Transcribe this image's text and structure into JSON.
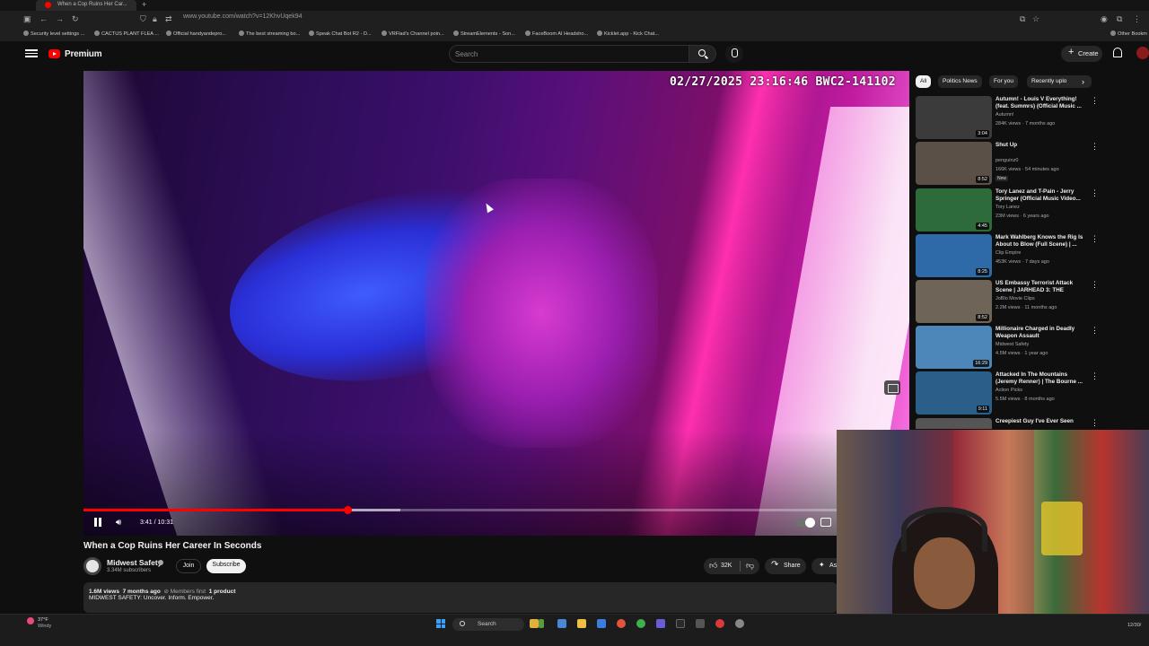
{
  "browser": {
    "tab_title": "When a Cop Ruins Her Car...",
    "url": "www.youtube.com/watch?v=12KhvUqek94",
    "bookmarks": [
      "Security level settings ...",
      "CACTUS PLANT FLEA ...",
      "Official handyandepro...",
      "The best streaming bo...",
      "Speak Chat Bot R2 - D...",
      "VRFlad's Channel poin...",
      "StreamElements - Son...",
      "FaceBoom AI Headsho...",
      "Kicklet.app - Kick Chat..."
    ],
    "other_bookmarks": "Other Bookm"
  },
  "header": {
    "logo_text": "Premium",
    "search_placeholder": "Search",
    "create_label": "Create"
  },
  "player": {
    "overlay_timestamp": "02/27/2025 23:16:46 BWC2-141102",
    "current_time": "3:41",
    "duration": "10:31",
    "time_display": "3:41 / 10:31",
    "progress_fraction": 0.35,
    "buffered_fraction": 0.42,
    "state": "playing"
  },
  "video": {
    "title": "When a Cop Ruins Her Career In Seconds",
    "channel": "Midwest Safety",
    "subscribers": "3.34M subscribers",
    "join_label": "Join",
    "subscribe_label": "Subscribe",
    "likes": "32K",
    "share_label": "Share",
    "ask_label": "As",
    "views": "1.6M views",
    "age": "7 months ago",
    "members_first": "Members first",
    "products": "1 product",
    "description": "MIDWEST SAFETY: Uncover. Inform. Empower."
  },
  "chips": [
    {
      "label": "All",
      "active": true
    },
    {
      "label": "Politics News",
      "active": false
    },
    {
      "label": "For you",
      "active": false
    },
    {
      "label": "Recently uplo",
      "active": false
    }
  ],
  "recommendations": [
    {
      "title": "Autumn! - Louis V Everything! (feat. Summrs) (Official Music ...",
      "channel": "Autumn!",
      "meta": "284K views · 7 months ago",
      "duration": "3:04",
      "badge": "",
      "color": "#3b3b3b"
    },
    {
      "title": "Shut Up",
      "channel": "penguinz0",
      "meta": "166K views · 54 minutes ago",
      "duration": "8:52",
      "badge": "New",
      "color": "#5a5048"
    },
    {
      "title": "Tory Lanez and T-Pain - Jerry Springer (Official Music Video...",
      "channel": "Tory Lanez",
      "meta": "23M views · 6 years ago",
      "duration": "4:45",
      "badge": "",
      "color": "#2e6b3a"
    },
    {
      "title": "Mark Wahlberg Knows the Rig Is About to Blow (Full Scene) | ...",
      "channel": "Clip Empire",
      "meta": "453K views · 7 days ago",
      "duration": "8:25",
      "badge": "",
      "color": "#2f6aa8"
    },
    {
      "title": "US Embassy Terrorist Attack Scene | JARHEAD 3: THE SIEGE...",
      "channel": "JoBlo Movie Clips",
      "meta": "2.2M views · 11 months ago",
      "duration": "8:52",
      "badge": "",
      "color": "#6e6458"
    },
    {
      "title": "Millionaire Charged in Deadly Weapon Assault",
      "channel": "Midwest Safety",
      "meta": "4.5M views · 1 year ago",
      "duration": "16:29",
      "badge": "",
      "color": "#4d86b8"
    },
    {
      "title": "Attacked In The Mountains (Jeremy Renner) | The Bourne ...",
      "channel": "Action Picks",
      "meta": "5.5M views · 8 months ago",
      "duration": "9:11",
      "badge": "",
      "color": "#2b5f8a"
    },
    {
      "title": "Creepiest Guy I've Ever Seen",
      "channel": "",
      "meta": "",
      "duration": "",
      "badge": "",
      "color": "#555"
    }
  ],
  "taskbar": {
    "temperature": "37°F",
    "weather": "Windy",
    "search_label": "Search",
    "date": "12/30/"
  }
}
